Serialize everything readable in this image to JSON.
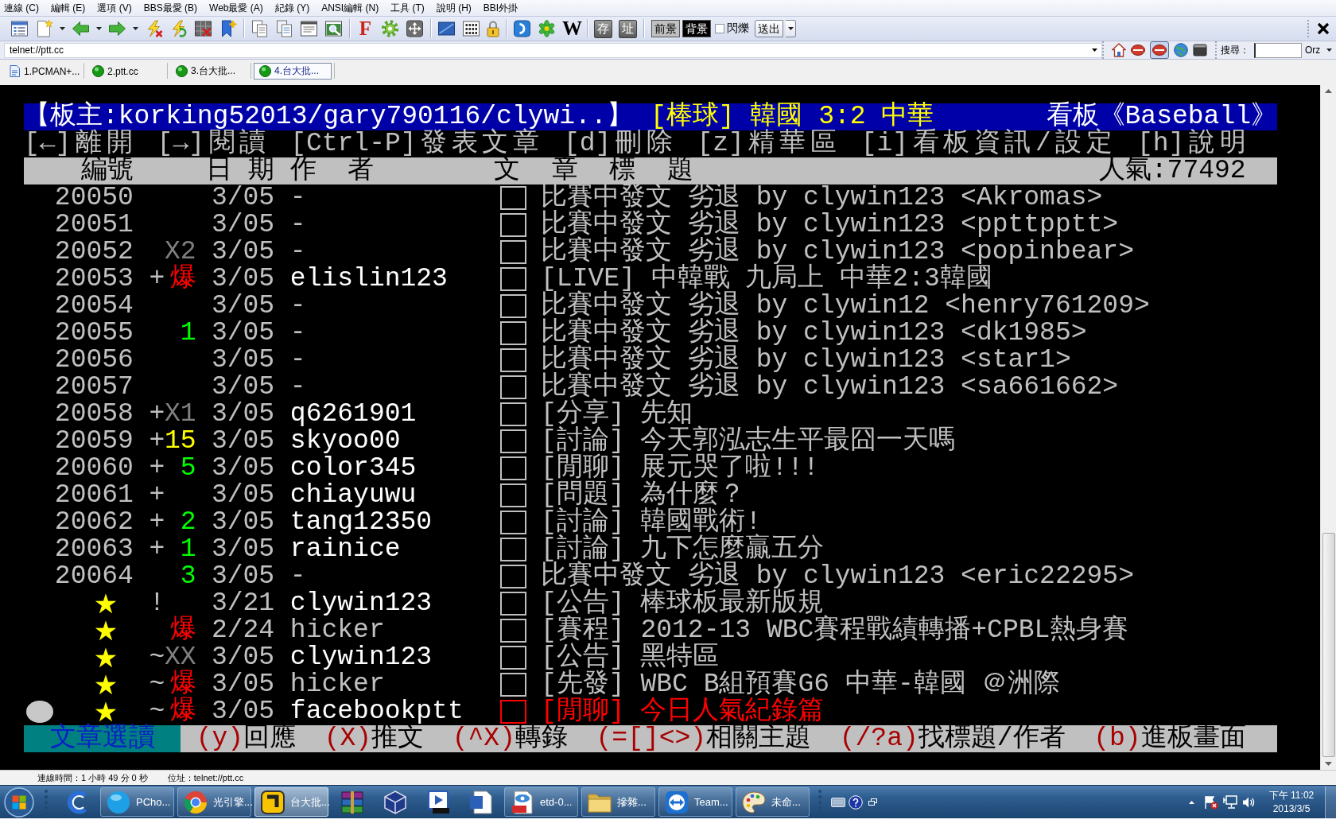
{
  "menu": [
    "連線 (C)",
    "編輯 (E)",
    "選項 (V)",
    "BBS最愛 (B)",
    "Web最愛 (A)",
    "紀錄 (Y)",
    "ANSI編輯 (N)",
    "工具 (T)",
    "說明 (H)",
    "BBI外掛"
  ],
  "toolbar": {
    "font_button": "F",
    "wiki_button": "W",
    "save_button": "存",
    "address_button": "址",
    "foreground_button": "前景",
    "background_button": "背景",
    "blink": {
      "label": "閃爍",
      "checked": false
    },
    "send_button": "送出"
  },
  "address_bar": {
    "address": "telnet://ptt.cc",
    "search_label": "搜尋：",
    "search_engine": "Orz"
  },
  "tabs": [
    {
      "label": "1.PCMAN+...",
      "kind": "page",
      "selected": false
    },
    {
      "label": "2.ptt.cc",
      "kind": "connection",
      "selected": false
    },
    {
      "label": "3.台大批...",
      "kind": "connection",
      "selected": false
    },
    {
      "label": "4.台大批...",
      "kind": "connection",
      "selected": true
    }
  ],
  "terminal": {
    "board_title": {
      "moderators": "【板主:korking52013/gary790116/clywi..】",
      "topic": "[棒球] 韓國 3:2 中華",
      "board": "看板《Baseball》"
    },
    "commands": "[←]離開 [→]閱讀 [Ctrl-P]發表文章 [d]刪除 [z]精華區 [i]看板資訊/設定 [h]說明",
    "columns": [
      "編號",
      "日 期",
      "作  者",
      "文  章  標  題"
    ],
    "popularity": "人氣:77492",
    "rows": [
      {
        "kind": "article",
        "number": "20050",
        "date": "3/05",
        "author": {
          "name": "-",
          "color": "#c0c0c0"
        },
        "title": "比賽中發文 劣退 by clywin123 <Akromas>",
        "color": "#c0c0c0",
        "selected": false
      },
      {
        "kind": "article",
        "number": "20051",
        "date": "3/05",
        "author": {
          "name": "-",
          "color": "#c0c0c0"
        },
        "title": "比賽中發文 劣退 by clywin123 <ppttpptt>",
        "color": "#c0c0c0",
        "selected": false
      },
      {
        "kind": "article",
        "number": "20052",
        "push": {
          "text": "X2",
          "color": "#808080"
        },
        "date": "3/05",
        "author": {
          "name": "-",
          "color": "#c0c0c0"
        },
        "title": "比賽中發文 劣退 by clywin123 <popinbear>",
        "color": "#c0c0c0",
        "selected": false
      },
      {
        "kind": "article",
        "number": "20053",
        "unread": "+",
        "push": {
          "text": "爆",
          "color": "#ff0000"
        },
        "date": "3/05",
        "author": {
          "name": "elislin123",
          "color": "#ffffff"
        },
        "title": "[LIVE] 中韓戰 九局上 中華2:3韓國",
        "color": "#c0c0c0",
        "selected": false
      },
      {
        "kind": "article",
        "number": "20054",
        "date": "3/05",
        "author": {
          "name": "-",
          "color": "#c0c0c0"
        },
        "title": "比賽中發文 劣退 by clywin12 <henry761209>",
        "color": "#c0c0c0",
        "selected": false
      },
      {
        "kind": "article",
        "number": "20055",
        "push": {
          "text": "1",
          "color": "#00ff00"
        },
        "date": "3/05",
        "author": {
          "name": "-",
          "color": "#c0c0c0"
        },
        "title": "比賽中發文 劣退 by clywin123 <dk1985>",
        "color": "#c0c0c0",
        "selected": false
      },
      {
        "kind": "article",
        "number": "20056",
        "date": "3/05",
        "author": {
          "name": "-",
          "color": "#c0c0c0"
        },
        "title": "比賽中發文 劣退 by clywin123 <star1>",
        "color": "#c0c0c0",
        "selected": false
      },
      {
        "kind": "article",
        "number": "20057",
        "date": "3/05",
        "author": {
          "name": "-",
          "color": "#c0c0c0"
        },
        "title": "比賽中發文 劣退 by clywin123 <sa661662>",
        "color": "#c0c0c0",
        "selected": false
      },
      {
        "kind": "article",
        "number": "20058",
        "unread": "+",
        "push": {
          "text": "X1",
          "color": "#808080"
        },
        "date": "3/05",
        "author": {
          "name": "q6261901",
          "color": "#ffffff"
        },
        "title": "[分享] 先知",
        "color": "#c0c0c0",
        "selected": false
      },
      {
        "kind": "article",
        "number": "20059",
        "unread": "+",
        "push": {
          "text": "15",
          "color": "#ffff00"
        },
        "date": "3/05",
        "author": {
          "name": "skyoo00",
          "color": "#ffffff"
        },
        "title": "[討論] 今天郭泓志生平最囧一天嗎",
        "color": "#c0c0c0",
        "selected": false
      },
      {
        "kind": "article",
        "number": "20060",
        "unread": "+",
        "push": {
          "text": "5",
          "color": "#00ff00"
        },
        "date": "3/05",
        "author": {
          "name": "color345",
          "color": "#ffffff"
        },
        "title": "[閒聊] 展元哭了啦!!!",
        "color": "#c0c0c0",
        "selected": false
      },
      {
        "kind": "article",
        "number": "20061",
        "unread": "+",
        "date": "3/05",
        "author": {
          "name": "chiayuwu",
          "color": "#ffffff"
        },
        "title": "[問題] 為什麼？",
        "color": "#c0c0c0",
        "selected": false
      },
      {
        "kind": "article",
        "number": "20062",
        "unread": "+",
        "push": {
          "text": "2",
          "color": "#00ff00"
        },
        "date": "3/05",
        "author": {
          "name": "tang12350",
          "color": "#ffffff"
        },
        "title": "[討論] 韓國戰術!",
        "color": "#c0c0c0",
        "selected": false
      },
      {
        "kind": "article",
        "number": "20063",
        "unread": "+",
        "push": {
          "text": "1",
          "color": "#00ff00"
        },
        "date": "3/05",
        "author": {
          "name": "rainice",
          "color": "#ffffff"
        },
        "title": "[討論] 九下怎麼贏五分",
        "color": "#c0c0c0",
        "selected": false
      },
      {
        "kind": "article",
        "number": "20064",
        "push": {
          "text": "3",
          "color": "#00ff00"
        },
        "date": "3/05",
        "author": {
          "name": "-",
          "color": "#c0c0c0"
        },
        "title": "比賽中發文 劣退 by clywin123 <eric22295>",
        "color": "#c0c0c0",
        "selected": false
      },
      {
        "kind": "pinned",
        "marker": "★",
        "unread": "!",
        "date": "3/21",
        "author": {
          "name": "clywin123",
          "color": "#ffffff"
        },
        "title": "[公告] 棒球板最新版規",
        "color": "#c0c0c0",
        "selected": false
      },
      {
        "kind": "pinned",
        "marker": "★",
        "push": {
          "text": "爆",
          "color": "#ff0000"
        },
        "date": "2/24",
        "author": {
          "name": "hicker",
          "color": "#c0c0c0"
        },
        "title": "[賽程] 2012-13 WBC賽程戰績轉播+CPBL熱身賽",
        "color": "#c0c0c0",
        "selected": false
      },
      {
        "kind": "pinned",
        "marker": "★",
        "unread": "~",
        "push": {
          "text": "XX",
          "color": "#808080"
        },
        "date": "3/05",
        "author": {
          "name": "clywin123",
          "color": "#ffffff"
        },
        "title": "[公告] 黑特區",
        "color": "#c0c0c0",
        "selected": false
      },
      {
        "kind": "pinned",
        "marker": "★",
        "unread": "~",
        "push": {
          "text": "爆",
          "color": "#ff0000"
        },
        "date": "3/05",
        "author": {
          "name": "hicker",
          "color": "#c0c0c0"
        },
        "title": "[先發] WBC B組預賽G6 中華-韓國 ＠洲際",
        "color": "#c0c0c0",
        "selected": false
      },
      {
        "kind": "pinned",
        "marker": "★",
        "unread": "~",
        "push": {
          "text": "爆",
          "color": "#ff0000"
        },
        "date": "3/05",
        "author": {
          "name": "facebookptt",
          "color": "#ffffff"
        },
        "title": "[閒聊] 今日人氣紀錄篇",
        "color": "#ff0000",
        "selected": true
      }
    ],
    "footer": {
      "mode": "文章選讀",
      "hints": [
        {
          "key": "(y)",
          "label": "回應"
        },
        {
          "key": "(X)",
          "label": "推文"
        },
        {
          "key": "(^X)",
          "label": "轉錄"
        },
        {
          "key": "(=[]<>)",
          "label": "相關主題"
        },
        {
          "key": "(/?a)",
          "label": "找標題/作者"
        },
        {
          "key": "(b)",
          "label": "進板畫面"
        }
      ]
    }
  },
  "status_bar": {
    "connection_time": "連線時間：1 小時 49 分 0 秒",
    "address": "位址：telnet://ptt.cc"
  },
  "taskbar": {
    "items": [
      {
        "kind": "pinned"
      },
      {
        "kind": "window",
        "label": "PCho...",
        "selected": false
      },
      {
        "kind": "window",
        "label": "光引擎...",
        "selected": false
      },
      {
        "kind": "window",
        "label": "台大批...",
        "selected": true
      },
      {
        "kind": "pinned"
      },
      {
        "kind": "pinned"
      },
      {
        "kind": "pinned"
      },
      {
        "kind": "pinned"
      },
      {
        "kind": "window",
        "label": "etd-0...",
        "selected": false
      },
      {
        "kind": "window",
        "label": "摻雜...",
        "selected": false
      },
      {
        "kind": "window",
        "label": "Team...",
        "selected": false
      },
      {
        "kind": "window",
        "label": "未命...",
        "selected": false
      }
    ],
    "clock": {
      "time": "下午 11:02",
      "date": "2013/3/5"
    }
  }
}
